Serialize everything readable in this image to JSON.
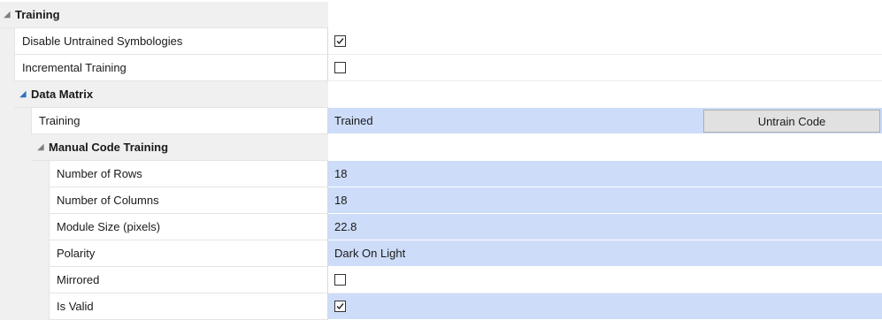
{
  "grid": {
    "training": {
      "label": "Training",
      "disable_untrained": {
        "label": "Disable Untrained Symbologies",
        "checked": true
      },
      "incremental": {
        "label": "Incremental Training",
        "checked": false
      },
      "data_matrix": {
        "label": "Data Matrix",
        "training": {
          "label": "Training",
          "value": "Trained",
          "button_label": "Untrain Code"
        },
        "manual": {
          "label": "Manual Code Training",
          "rows": {
            "label": "Number of Rows",
            "value": "18"
          },
          "columns": {
            "label": "Number of Columns",
            "value": "18"
          },
          "module_size": {
            "label": "Module Size (pixels)",
            "value": "22.8"
          },
          "polarity": {
            "label": "Polarity",
            "value": "Dark On Light"
          },
          "mirrored": {
            "label": "Mirrored",
            "checked": false
          },
          "is_valid": {
            "label": "Is Valid",
            "checked": true
          }
        }
      }
    }
  },
  "colors": {
    "gutter": "#f0f0f0",
    "value_highlight": "#cddcf9",
    "expander_blue": "#2e6fbf"
  },
  "icons": {
    "collapse": "triangle-down-right-icon",
    "check": "checkmark-icon"
  }
}
